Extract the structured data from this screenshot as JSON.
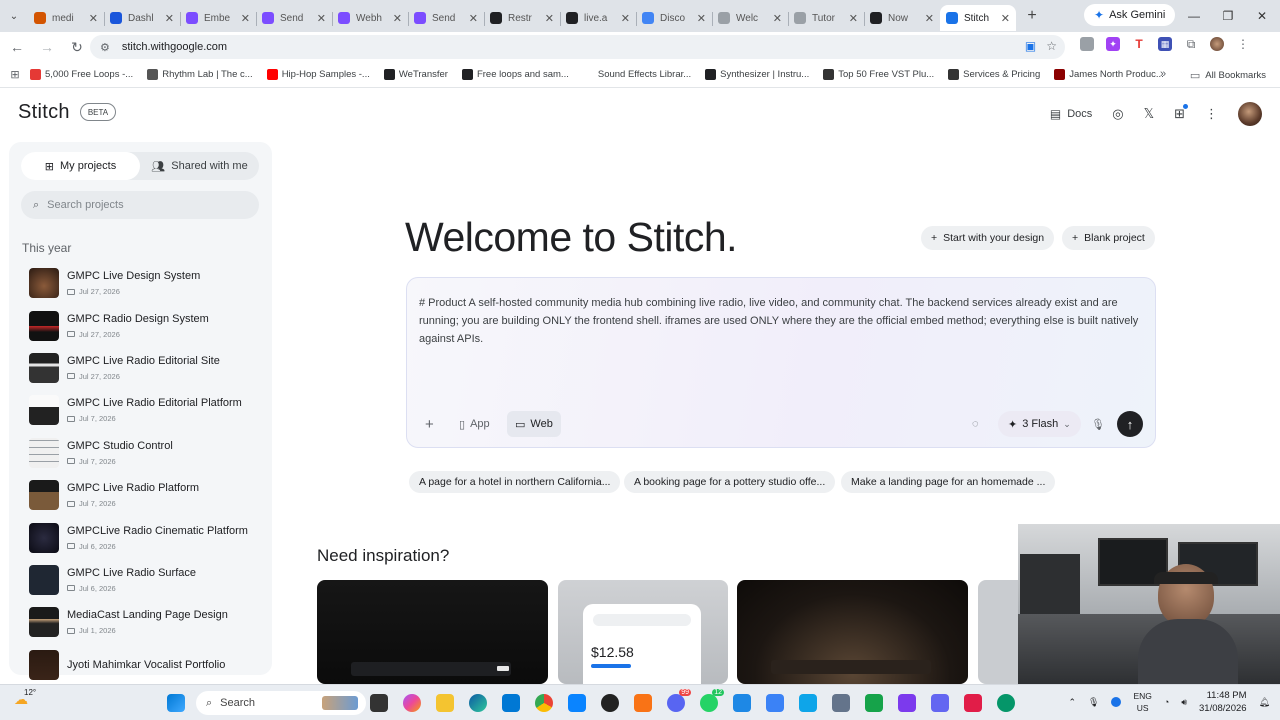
{
  "browser": {
    "tabs": [
      {
        "label": "medi",
        "icon": "x-icon",
        "color": "#d35400"
      },
      {
        "label": "Dashl",
        "icon": "shield-icon",
        "color": "#1a56db"
      },
      {
        "label": "Embe",
        "icon": "discord-icon",
        "color": "#7c4dff"
      },
      {
        "label": "Send",
        "icon": "discord-icon",
        "color": "#7c4dff"
      },
      {
        "label": "Webh",
        "icon": "discord-icon",
        "color": "#7c4dff"
      },
      {
        "label": "Send",
        "icon": "discord-icon",
        "color": "#7c4dff"
      },
      {
        "label": "Restr",
        "icon": "circle-icon",
        "color": "#202124"
      },
      {
        "label": "live.a",
        "icon": "github-icon",
        "color": "#202124"
      },
      {
        "label": "Disco",
        "icon": "google-icon",
        "color": "#4285f4"
      },
      {
        "label": "Welc",
        "icon": "doc-icon",
        "color": "#9aa0a6"
      },
      {
        "label": "Tutor",
        "icon": "doc-icon",
        "color": "#9aa0a6"
      },
      {
        "label": "Now",
        "icon": "app-icon",
        "color": "#202124"
      },
      {
        "label": "Stitch",
        "icon": "stitch-icon",
        "color": "#1a73e8",
        "active": true
      }
    ],
    "ask_gemini": "Ask Gemini",
    "url": "stitch.withgoogle.com",
    "bookmarks": [
      {
        "label": "5,000 Free Loops -...",
        "color": "#e53935"
      },
      {
        "label": "Rhythm Lab | The c...",
        "color": "#555555"
      },
      {
        "label": "Hip-Hop Samples -...",
        "color": "#ff0000"
      },
      {
        "label": "WeTransfer",
        "color": "#202124"
      },
      {
        "label": "Free loops and sam...",
        "color": "#202124"
      },
      {
        "label": "Sound Effects Librar...",
        "color": "#ffffff"
      },
      {
        "label": "Synthesizer | Instru...",
        "color": "#202124"
      },
      {
        "label": "Top 50 Free VST Plu...",
        "color": "#333333"
      },
      {
        "label": "Services & Pricing",
        "color": "#333333"
      },
      {
        "label": "James North Produc...",
        "color": "#8b0000"
      }
    ],
    "all_bookmarks": "All Bookmarks"
  },
  "app": {
    "logo": "Stitch",
    "badge": "BETA",
    "docs": "Docs"
  },
  "sidebar": {
    "tab_my": "My projects",
    "tab_shared": "Shared with me",
    "search_placeholder": "Search projects",
    "section": "This year",
    "projects": [
      {
        "name": "GMPC Live Design System",
        "date": "Jul 27, 2026"
      },
      {
        "name": "GMPC Radio Design System",
        "date": "Jul 27, 2026"
      },
      {
        "name": "GMPC Live Radio Editorial Site",
        "date": "Jul 27, 2026"
      },
      {
        "name": "GMPC Live Radio Editorial Platform",
        "date": "Jul 7, 2026"
      },
      {
        "name": "GMPC Studio Control",
        "date": "Jul 7, 2026"
      },
      {
        "name": "GMPC Live Radio Platform",
        "date": "Jul 7, 2026"
      },
      {
        "name": "GMPCLive Radio Cinematic Platform",
        "date": "Jul 6, 2026"
      },
      {
        "name": "GMPC Live Radio Surface",
        "date": "Jul 6, 2026"
      },
      {
        "name": "MediaCast Landing Page Design",
        "date": "Jul 1, 2026"
      },
      {
        "name": "Jyoti Mahimkar Vocalist Portfolio",
        "date": ""
      }
    ]
  },
  "main": {
    "welcome": "Welcome to Stitch.",
    "start_design": "Start with your design",
    "blank_project": "Blank project",
    "prompt_text": "# Product A self-hosted community media hub combining live radio, live video, and community chat. The backend services already exist and are running; you are building ONLY the frontend shell. iframes are used ONLY where they are the official embed method; everything else is built natively against APIs.",
    "app_label": "App",
    "web_label": "Web",
    "model": "3 Flash",
    "suggestions": [
      "A page for a hotel in northern California...",
      "A booking page for a pottery studio offe...",
      "Make a landing page for an homemade ..."
    ],
    "inspiration_title": "Need inspiration?",
    "card_price": "$12.58"
  },
  "taskbar": {
    "search_label": "Search",
    "weather_temp": "12°",
    "lang_top": "ENG",
    "lang_bottom": "US",
    "time": "11:48 PM",
    "date": "31/08/2026",
    "discord_badge": "99",
    "whatsapp_badge": "12"
  }
}
